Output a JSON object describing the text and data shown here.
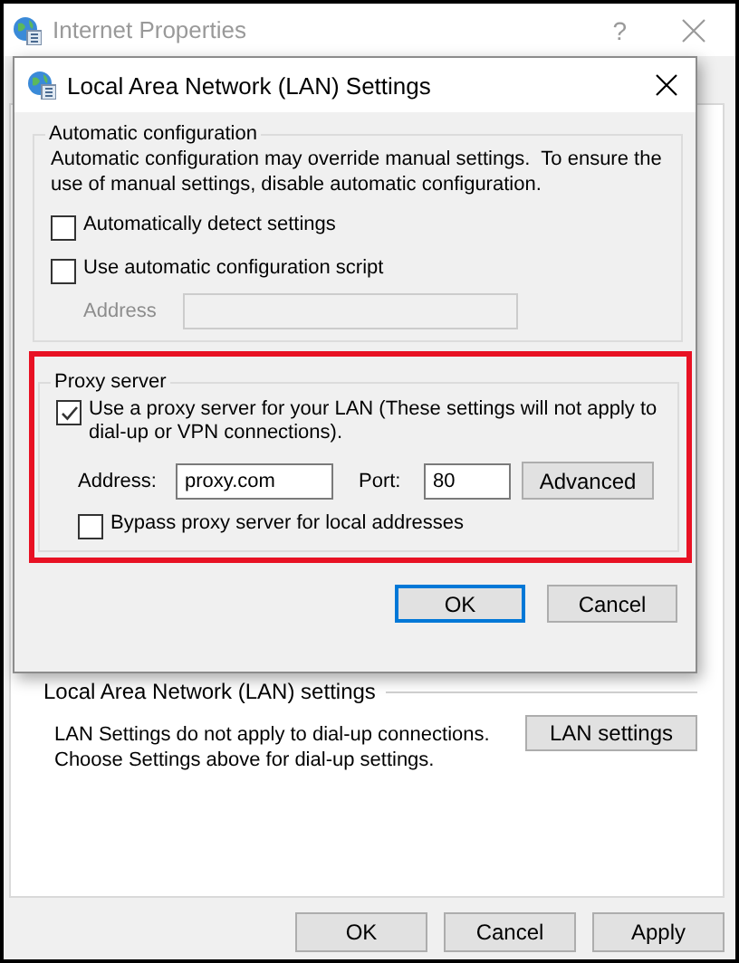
{
  "window": {
    "title": "Internet Properties",
    "help": "?"
  },
  "dialog": {
    "title": "Local Area Network (LAN) Settings",
    "automatic": {
      "heading": "Automatic configuration",
      "description": "Automatic configuration may override manual settings.  To ensure the\nuse of manual settings, disable automatic configuration.",
      "options": [
        {
          "label": "Automatically detect settings",
          "checked": false
        },
        {
          "label": "Use automatic configuration script",
          "checked": false
        }
      ],
      "address": {
        "label": "Address",
        "disabled": true
      }
    },
    "proxy": {
      "heading": "Proxy server",
      "use_proxy": {
        "label": "Use a proxy server for your LAN (These settings will not apply to\ndial-up or VPN connections).",
        "checked": true
      },
      "address": {
        "label": "Address:",
        "value": "proxy.com"
      },
      "port": {
        "label": "Port:",
        "value": "80"
      },
      "advanced": "Advanced",
      "bypass": {
        "label": "Bypass proxy server for local addresses",
        "checked": false
      }
    },
    "buttons": [
      {
        "label": "OK",
        "default": true
      },
      {
        "label": "Cancel",
        "default": false
      }
    ]
  },
  "lan_section": {
    "heading": "Local Area Network (LAN) settings",
    "note": "LAN Settings do not apply to dial-up connections.\nChoose Settings above for dial-up settings.",
    "button": "LAN settings"
  },
  "buttons": [
    "OK",
    "Cancel",
    "Apply"
  ]
}
